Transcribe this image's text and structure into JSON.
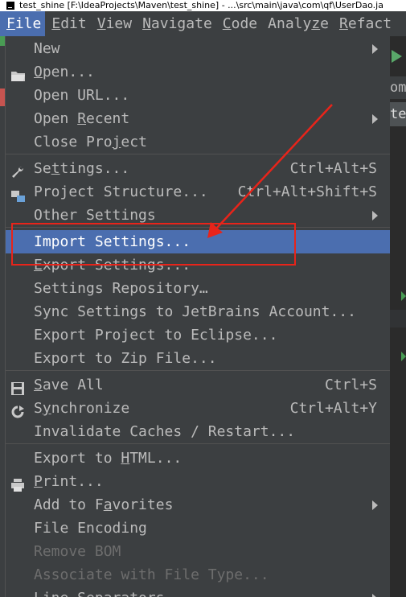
{
  "window": {
    "title": "test_shine [F:\\IdeaProjects\\Maven\\test_shine] - ...\\src\\main\\java\\com\\qf\\UserDao.ja"
  },
  "menubar": [
    {
      "pre": "",
      "u": "F",
      "post": "ile"
    },
    {
      "pre": "",
      "u": "E",
      "post": "dit"
    },
    {
      "pre": "",
      "u": "V",
      "post": "iew"
    },
    {
      "pre": "",
      "u": "N",
      "post": "avigate"
    },
    {
      "pre": "",
      "u": "C",
      "post": "ode"
    },
    {
      "pre": "Analy",
      "u": "z",
      "post": "e"
    },
    {
      "pre": "",
      "u": "R",
      "post": "efact"
    }
  ],
  "background": {
    "tab1": "om",
    "tab2": "te"
  },
  "file_menu": {
    "items": [
      {
        "pre": "New",
        "u": "",
        "post": "",
        "submenu": true
      },
      {
        "pre": "",
        "u": "O",
        "post": "pen...",
        "icon": "folder-icon"
      },
      {
        "pre": "Open URL...",
        "u": "",
        "post": ""
      },
      {
        "pre": "Open ",
        "u": "R",
        "post": "ecent",
        "submenu": true
      },
      {
        "pre": "Close Pro",
        "u": "j",
        "post": "ect"
      },
      {
        "pre": "Se",
        "u": "t",
        "post": "tings...",
        "shortcut": "Ctrl+Alt+S",
        "icon": "wrench-icon"
      },
      {
        "pre": "Project Structure...",
        "u": "",
        "post": "",
        "shortcut": "Ctrl+Alt+Shift+S",
        "icon": "project-structure-icon"
      },
      {
        "pre": "Other Settings",
        "u": "",
        "post": "",
        "submenu": true
      },
      {
        "pre": "Import Settings...",
        "u": "",
        "post": "",
        "selected": true
      },
      {
        "pre": "",
        "u": "E",
        "post": "xport Settings..."
      },
      {
        "pre": "Settings Repository…",
        "u": "",
        "post": ""
      },
      {
        "pre": "Sync Settings to JetBrains Account...",
        "u": "",
        "post": ""
      },
      {
        "pre": "Export Project to Eclipse...",
        "u": "",
        "post": ""
      },
      {
        "pre": "Export to Zip File...",
        "u": "",
        "post": ""
      },
      {
        "pre": "",
        "u": "S",
        "post": "ave All",
        "shortcut": "Ctrl+S",
        "icon": "save-icon"
      },
      {
        "pre": "S",
        "u": "y",
        "post": "nchronize",
        "shortcut": "Ctrl+Alt+Y",
        "icon": "sync-icon"
      },
      {
        "pre": "Invalidate Caches / Restart...",
        "u": "",
        "post": ""
      },
      {
        "pre": "Export to ",
        "u": "H",
        "post": "TML..."
      },
      {
        "pre": "",
        "u": "P",
        "post": "rint...",
        "icon": "print-icon"
      },
      {
        "pre": "Add to F",
        "u": "a",
        "post": "vorites",
        "submenu": true
      },
      {
        "pre": "File Encoding",
        "u": "",
        "post": ""
      },
      {
        "pre": "Remove BOM",
        "u": "",
        "post": "",
        "disabled": true
      },
      {
        "pre": "Associate with File Type...",
        "u": "",
        "post": "",
        "disabled": true
      },
      {
        "pre": "Line Separators",
        "u": "",
        "post": "",
        "submenu": true
      }
    ]
  },
  "colors": {
    "menu_bg": "#3c3f41",
    "selected": "#4b6eaf",
    "text": "#bbbbbb",
    "disabled": "#6d6d6d",
    "annotation": "#e8241a"
  }
}
